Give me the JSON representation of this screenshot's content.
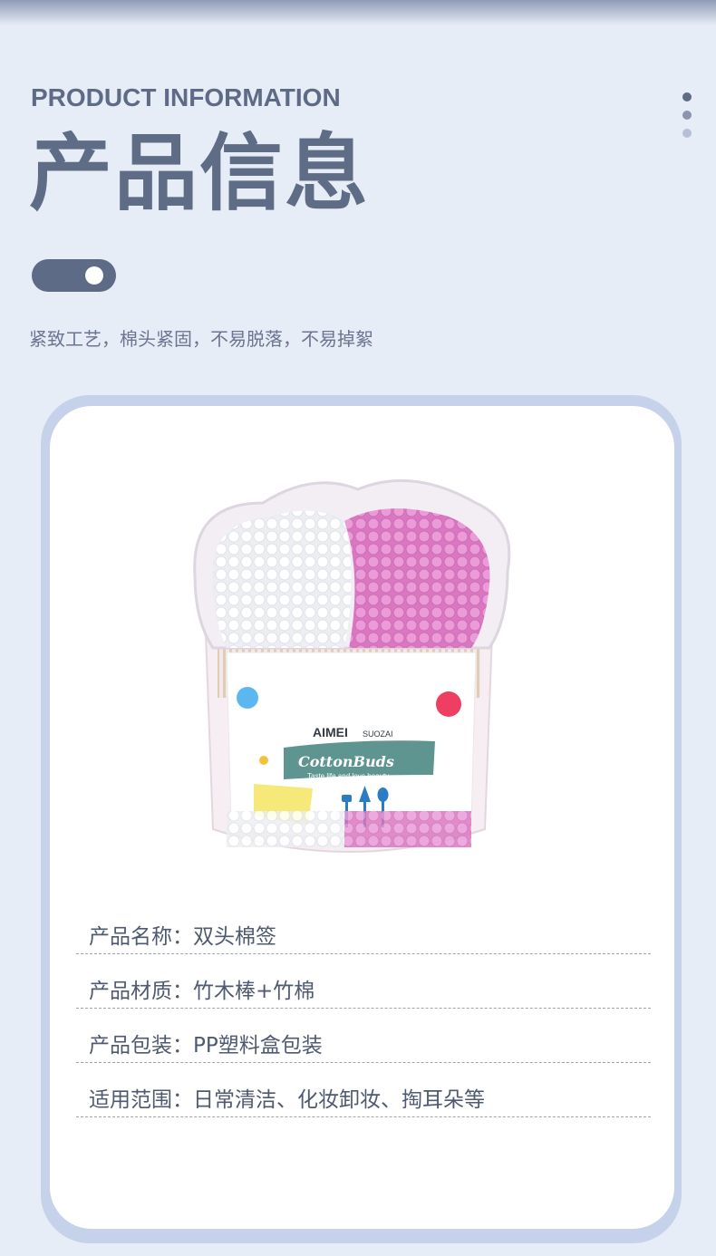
{
  "header": {
    "title_en": "PRODUCT INFORMATION",
    "title_cn": "产品信息",
    "subtitle": "紧致工艺，棉头紧固，不易脱落，不易掉絮"
  },
  "colors": {
    "background": "#e7edf7",
    "accent": "#5d6b86",
    "card_border": "#c5d2ea",
    "card": "#ffffff",
    "bud_white": "#ffffff",
    "bud_pink": "#e58fd0",
    "label_green": "#5f9591"
  },
  "product": {
    "brand": "AIMEI",
    "brand_suffix": "SUOZAI",
    "name": "CottonBuds",
    "slogan": "Taste life and love beauty"
  },
  "info_rows": [
    "产品名称：双头棉签",
    "产品材质：竹木棒+竹棉",
    "产品包装：PP塑料盒包装",
    "适用范围：日常清洁、化妆卸妆、掏耳朵等"
  ]
}
